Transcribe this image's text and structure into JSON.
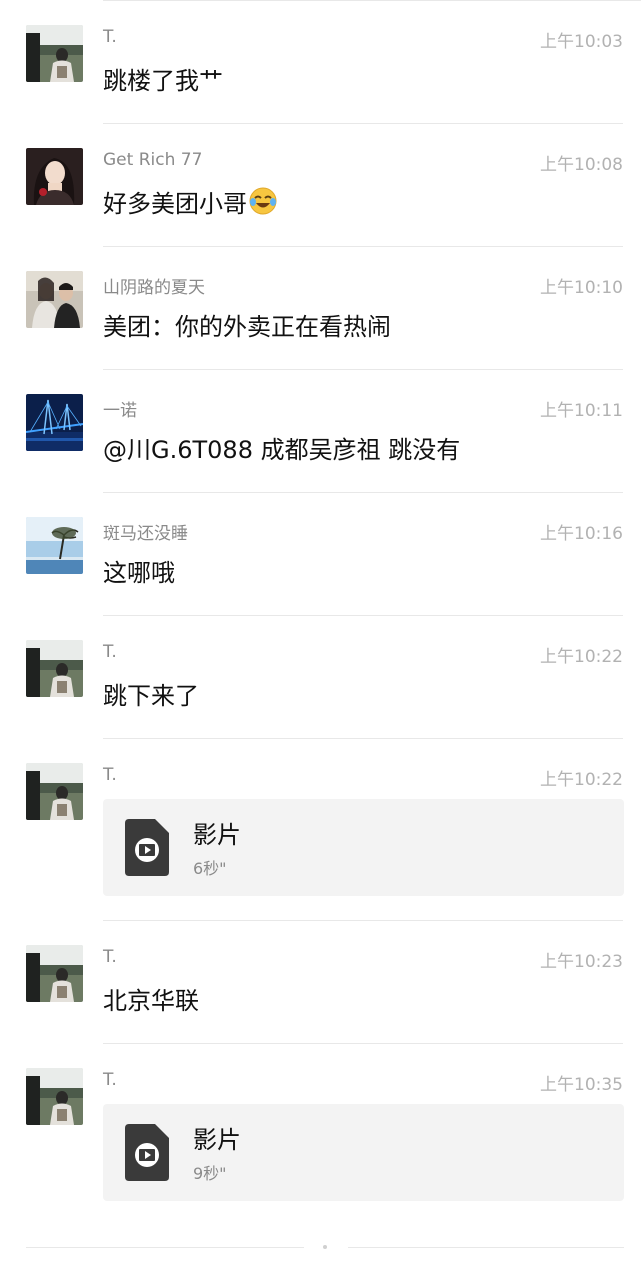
{
  "messages": [
    {
      "sender": "T.",
      "time": "上午10:03",
      "text": "跳楼了我艹"
    },
    {
      "sender": "Get Rich 77",
      "time": "上午10:08",
      "text": "好多美团小哥",
      "emoji": "face-with-tears-of-joy"
    },
    {
      "sender": "山阴路的夏天",
      "time": "上午10:10",
      "text": "美团：你的外卖正在看热闹"
    },
    {
      "sender": "一诺",
      "time": "上午10:11",
      "text": "@川G.6T088 成都吴彦祖 跳没有"
    },
    {
      "sender": "斑马还没睡",
      "time": "上午10:16",
      "text": "这哪哦"
    },
    {
      "sender": "T.",
      "time": "上午10:22",
      "text": "跳下来了"
    },
    {
      "sender": "T.",
      "time": "上午10:22",
      "video": {
        "title": "影片",
        "duration": "6秒\""
      }
    },
    {
      "sender": "T.",
      "time": "上午10:23",
      "text": "北京华联"
    },
    {
      "sender": "T.",
      "time": "上午10:35",
      "video": {
        "title": "影片",
        "duration": "9秒\""
      }
    }
  ],
  "icons": {
    "video_file": "video-file-icon",
    "emoji": "laughing-tears-emoji-icon"
  },
  "colors": {
    "name": "#8a8a8a",
    "time": "#b2b2b2",
    "text": "#111111",
    "card_bg": "#f3f3f3",
    "divider": "#e8e8e8"
  }
}
